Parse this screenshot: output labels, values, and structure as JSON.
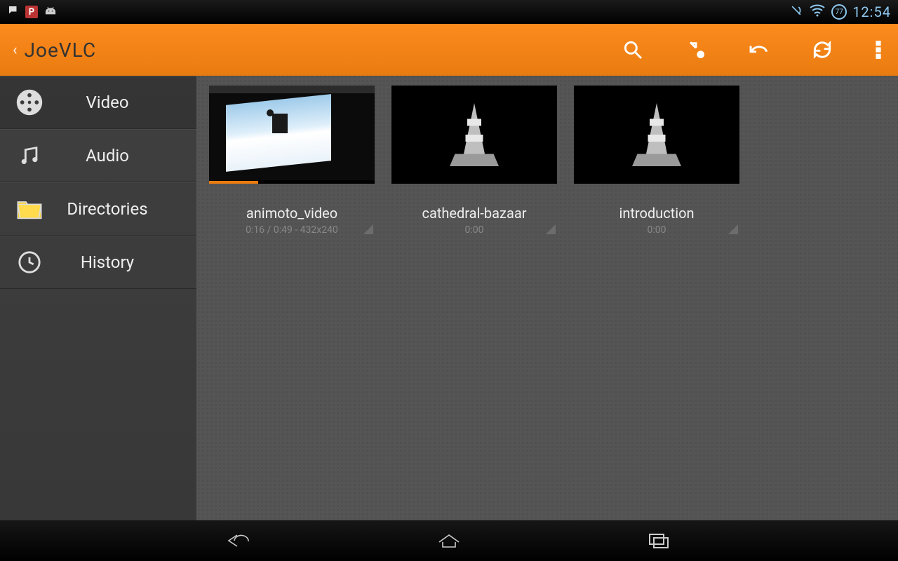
{
  "status_bar": {
    "clock": "12:54",
    "battery_pct": "77",
    "left_icons": [
      "chat-icon",
      "p-badge-icon",
      "android-head-icon"
    ],
    "right_icons": [
      "mute-icon",
      "wifi-icon",
      "battery-circle-icon"
    ]
  },
  "action_bar": {
    "title": "JoeVLC",
    "actions": [
      {
        "id": "search",
        "name": "search-icon"
      },
      {
        "id": "stream",
        "name": "open-stream-icon"
      },
      {
        "id": "undo",
        "name": "undo-icon"
      },
      {
        "id": "refresh",
        "name": "refresh-icon"
      },
      {
        "id": "overflow",
        "name": "overflow-menu-icon"
      }
    ]
  },
  "sidebar": {
    "items": [
      {
        "label": "Video",
        "icon": "film-reel-icon",
        "selected": true
      },
      {
        "label": "Audio",
        "icon": "music-note-icon",
        "selected": false
      },
      {
        "label": "Directories",
        "icon": "folder-icon",
        "selected": false
      },
      {
        "label": "History",
        "icon": "clock-icon",
        "selected": false
      }
    ]
  },
  "videos": [
    {
      "title": "animoto_video",
      "meta": "0:16 / 0:49 - 432x240",
      "thumb": "snowboarder"
    },
    {
      "title": "cathedral-bazaar",
      "meta": "0:00",
      "thumb": "cone"
    },
    {
      "title": "introduction",
      "meta": "0:00",
      "thumb": "cone"
    }
  ],
  "colors": {
    "accent": "#ed8415",
    "sidebar_bg": "#3b3b3b",
    "body_bg": "#545454",
    "folder": "#ffcc00"
  }
}
